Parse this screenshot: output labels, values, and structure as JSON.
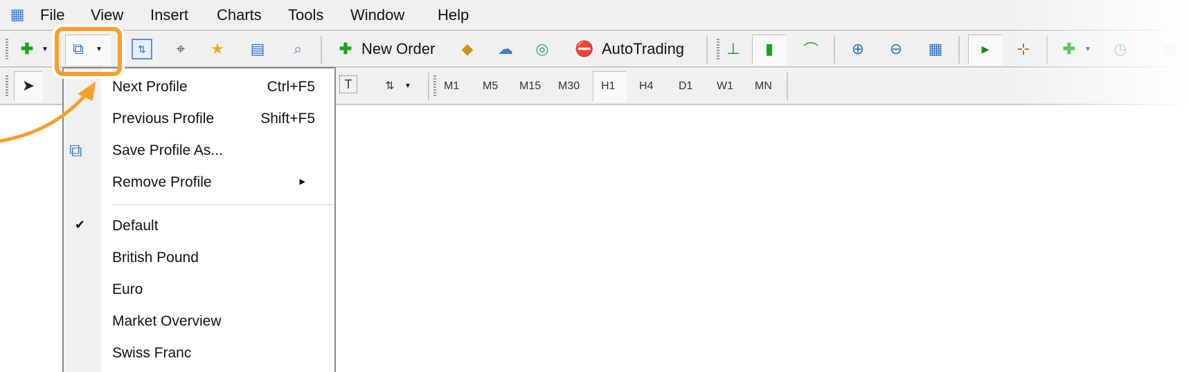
{
  "menubar": {
    "items": [
      "File",
      "View",
      "Insert",
      "Charts",
      "Tools",
      "Window",
      "Help"
    ]
  },
  "toolbar": {
    "new_order": "New Order",
    "autotrading": "AutoTrading"
  },
  "timeframes": [
    "M1",
    "M5",
    "M15",
    "M30",
    "H1",
    "H4",
    "D1",
    "W1",
    "MN"
  ],
  "selected_timeframe": "H1",
  "profiles_menu": {
    "items": [
      {
        "label": "Next Profile",
        "shortcut": "Ctrl+F5"
      },
      {
        "label": "Previous Profile",
        "shortcut": "Shift+F5"
      },
      {
        "label": "Save Profile As...",
        "icon": "save-profile-icon"
      },
      {
        "label": "Remove Profile",
        "submenu": true
      }
    ],
    "profiles": [
      "Default",
      "British Pound",
      "Euro",
      "Market Overview",
      "Swiss Franc"
    ],
    "checked": "Default"
  },
  "colors": {
    "highlight": "#f5a02a",
    "toolbar_bg": "#f0f0f0"
  }
}
